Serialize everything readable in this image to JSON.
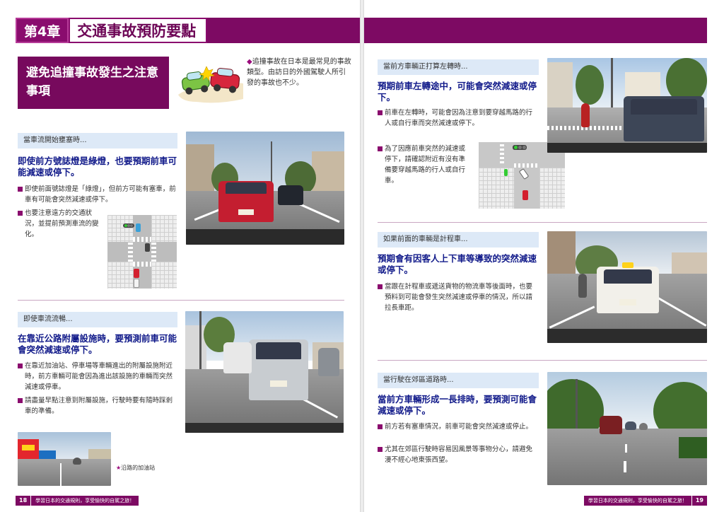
{
  "left_page": {
    "chapter_label": "第4章",
    "chapter_title": "交通事故預防要點",
    "section_title": "避免追撞事故發生之注意事項",
    "intro_mark": "◆",
    "intro_text": "追撞事故在日本是最常見的事故類型。由訪日的外國駕駛人所引發的事故也不少。",
    "block1": {
      "header": "當車流開始壅塞時...",
      "lead": "即使前方號誌燈是綠燈，也要預期前車可能減速或停下。",
      "bullets": [
        "即使前面號誌燈是「綠燈」，但前方可能有塞車，前車有可能會突然減速或停下。",
        "也要注意遠方的交通狀況，並提前預測車流的變化。"
      ]
    },
    "block2": {
      "header": "即使車流流暢...",
      "lead": "在靠近公路附屬設施時，要預測前車可能會突然減速或停下。",
      "bullets": [
        "在靠近加油站、停車場等車輛進出的附屬設施附近時，前方車輛可能會因為進出該設施的車輛而突然減速或停車。",
        "請盡量早點注意到附屬設施，行駛時要有隨時踩剎車的準備。"
      ],
      "caption_mark": "★",
      "caption": "沿路的加油站"
    },
    "footer_page": "18",
    "footer_text": "學習日本的交通規則，享受愉快的自駕之旅！"
  },
  "right_page": {
    "block1": {
      "header": "當前方車輛正打算左轉時...",
      "lead": "預期前車左轉途中，可能會突然減速或停下。",
      "bullets": [
        "前車在左轉時，可能會因為注意到要穿越馬路的行人或自行車而突然減速或停下。",
        "為了因應前車突然的減速或停下，請確認附近有沒有準備要穿越馬路的行人或自行車。"
      ]
    },
    "block2": {
      "header": "如果前面的車輛是計程車...",
      "lead": "預期會有因客人上下車等導致的突然減速或停下。",
      "bullets": [
        "當跟在計程車或遞送貨物的物流車等後面時，也要預料到可能會發生突然減速或停車的情況，所以請拉長車距。"
      ]
    },
    "block3": {
      "header": "當行駛在郊區道路時...",
      "lead": "當前方車輛形成一長排時，要預測可能會減速或停下。",
      "bullets": [
        "前方若有塞車情況，前車可能會突然減速或停止。",
        "尤其在郊區行駛時容易因風景等事物分心，請避免漫不經心地東張西望。"
      ]
    },
    "footer_page": "19",
    "footer_text": "學習日本的交通規則，享受愉快的自駕之旅！"
  },
  "photo_texts": {
    "plate_red": "",
    "plate_silver": "",
    "taxi_plate": ""
  },
  "colors": {
    "brand_purple": "#7d0a63",
    "heading_blue": "#111a8a",
    "header_band": "#dde9f7"
  }
}
